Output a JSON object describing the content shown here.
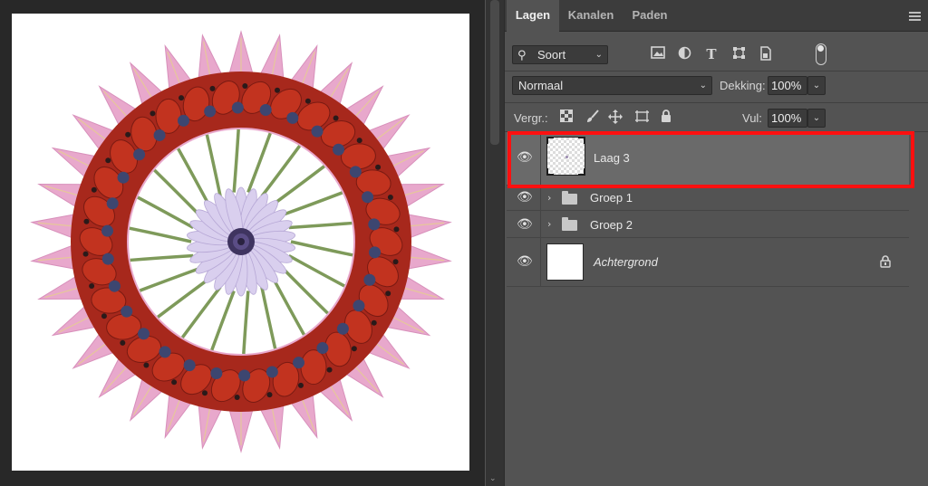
{
  "panel": {
    "tabs": [
      {
        "label": "Lagen",
        "active": true
      },
      {
        "label": "Kanalen",
        "active": false
      },
      {
        "label": "Paden",
        "active": false
      }
    ]
  },
  "filter": {
    "selected": "Soort",
    "icons": [
      "image-filter-icon",
      "adjustment-filter-icon",
      "type-filter-icon",
      "shape-filter-icon",
      "smart-object-filter-icon",
      "filter-toggle-icon"
    ]
  },
  "blend": {
    "mode": "Normaal",
    "opacity_label": "Dekking:",
    "opacity_value": "100%"
  },
  "lock": {
    "label": "Vergr.:",
    "icons": [
      "lock-transparent-icon",
      "lock-pixels-icon",
      "lock-position-icon",
      "lock-artboard-icon",
      "lock-all-icon"
    ],
    "fill_label": "Vul:",
    "fill_value": "100%"
  },
  "layers": [
    {
      "name": "Laag 3",
      "type": "pixel",
      "selected": true,
      "visible": true
    },
    {
      "name": "Groep 1",
      "type": "group",
      "selected": false,
      "visible": true
    },
    {
      "name": "Groep 2",
      "type": "group",
      "selected": false,
      "visible": true
    },
    {
      "name": "Achtergrond",
      "type": "background",
      "locked": true,
      "visible": true
    }
  ],
  "colors": {
    "highlight": "#ff1010",
    "panel_bg": "#535353",
    "selected_row": "#6a6a6a"
  }
}
